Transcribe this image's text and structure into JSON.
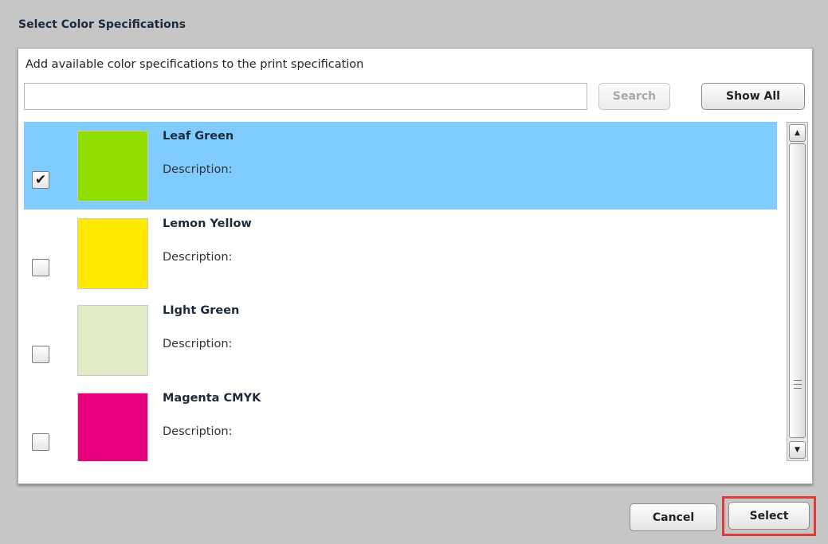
{
  "dialog": {
    "title": "Select Color Specifications",
    "instruction": "Add available color specifications to the print specification"
  },
  "search": {
    "value": "",
    "placeholder": "",
    "search_label": "Search",
    "show_all_label": "Show All"
  },
  "colors": [
    {
      "name": "Leaf Green",
      "description_label": "Description:",
      "swatch": "#90dd00",
      "checked": true,
      "check_mark": "✔"
    },
    {
      "name": "Lemon Yellow",
      "description_label": "Description:",
      "swatch": "#ffea00",
      "checked": false,
      "check_mark": ""
    },
    {
      "name": "LIght Green",
      "description_label": "Description:",
      "swatch": "#e1ecc6",
      "checked": false,
      "check_mark": ""
    },
    {
      "name": "Magenta CMYK",
      "description_label": "Description:",
      "swatch": "#e6007e",
      "checked": false,
      "check_mark": ""
    }
  ],
  "footer": {
    "cancel_label": "Cancel",
    "select_label": "Select"
  },
  "theme": {
    "selected_row": "#80ccff",
    "highlight": "#e03c3c"
  }
}
